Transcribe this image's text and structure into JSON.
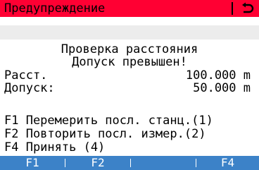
{
  "titlebar": {
    "title": "Предупреждение",
    "back_icon": "back-arrow-icon",
    "color": "#ff0033"
  },
  "message": {
    "line1": "Проверка расстояния",
    "line2": "Допуск превышен!"
  },
  "values": {
    "distance_label": "Расст.",
    "distance_value": "100.000 m",
    "tolerance_label": "Допуск:",
    "tolerance_value": "50.000 m"
  },
  "options": [
    "F1 Перемерить посл. станц.(1)",
    "F2 Повторить посл. измер.(2)",
    "F4 Принять (4)"
  ],
  "fkeys": {
    "f1": "F1",
    "f2": "F2",
    "f3": "",
    "f4": "F4",
    "color": "#3c82c8"
  }
}
